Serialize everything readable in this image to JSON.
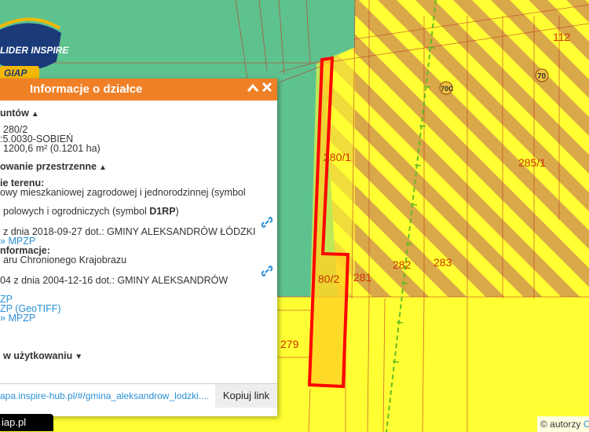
{
  "map": {
    "labels": {
      "l112": "112",
      "l70c": "70C",
      "l70": "70",
      "l280_1": "280/1",
      "l285_1": "285/1",
      "l282": "282",
      "l283": "283",
      "l280_2": "80/2",
      "l281": "281",
      "l279": "279"
    },
    "colors": {
      "green": "#5ec28e",
      "yellow": "#ffff33",
      "stripe": "#d9a848",
      "parcel_border": "#ff0000",
      "parcel_fill": "#ffcc22",
      "label": "#cc3300",
      "railway": "#66bb22"
    }
  },
  "logo": {
    "line1": "LIDER INSPIRE",
    "line2": "GIAP"
  },
  "panel": {
    "title": "Informacje o działce",
    "collapse_icon": "chevron-up-icon",
    "close_icon": "close-icon",
    "section1_header": "untów",
    "row_parcel": "280/2",
    "row_obreb": ":5.0030-SOBIEŃ",
    "row_area": "1200,6 m² (0.1201 ha)",
    "section2_header": "owanie przestrzenne",
    "przeznaczenie_label": "ie terenu:",
    "przeznaczenie_text1": "owy mieszkaniowej zagrodowej i jednorodzinnej (symbol",
    "przeznaczenie_text2_pre": "polowych i ogrodniczych (symbol ",
    "przeznaczenie_text2_sym": "D1RP",
    "przeznaczenie_text2_post": ")",
    "uchwala1": "z dnia 2018-09-27 dot.: GMINY ALEKSANDRÓW ŁÓDZKI",
    "uchwala1_link": "MPZP",
    "informacje_label": "nformacje:",
    "informacje_text": "aru Chronionego Krajobrazu",
    "uchwala2": "04 z dnia 2004-12-16 dot.: GMINY ALEKSANDRÓW",
    "link_zp": "ZP",
    "link_geotiff": "ZP (GeoTIFF)",
    "link_mpzp2": "MPZP",
    "section3_header": "w użytkowaniu",
    "footer_url": "apa.inspire-hub.pl/#/gmina_aleksandrow_lodzki....",
    "copy_button": "Kopiuj link"
  },
  "status_text": "iap.pl",
  "attribution": {
    "prefix": "© autorzy ",
    "link": "C"
  }
}
